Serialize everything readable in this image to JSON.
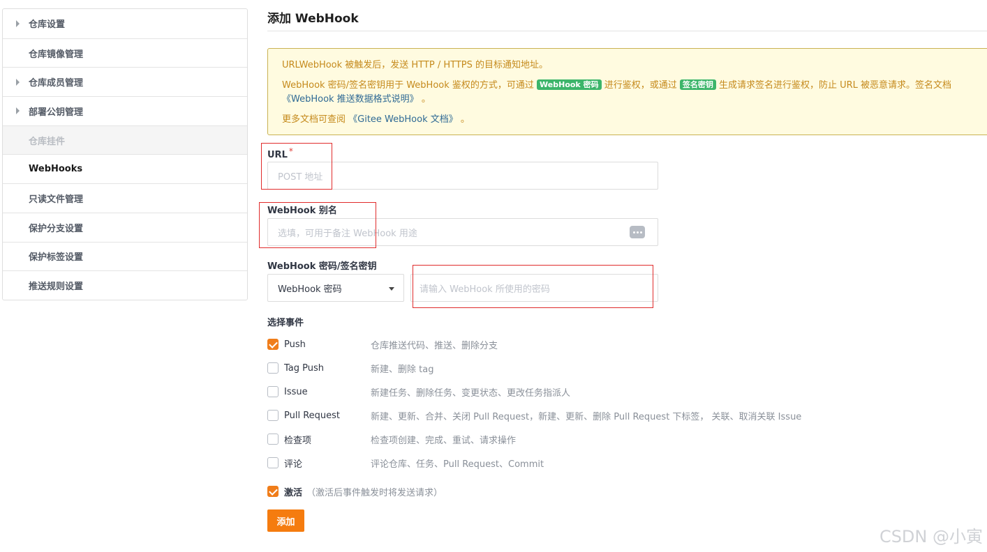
{
  "sidebar": {
    "items": [
      {
        "label": "仓库设置",
        "has_caret": true,
        "state": "normal"
      },
      {
        "label": "仓库镜像管理",
        "has_caret": false,
        "state": "normal"
      },
      {
        "label": "仓库成员管理",
        "has_caret": true,
        "state": "normal"
      },
      {
        "label": "部署公钥管理",
        "has_caret": true,
        "state": "normal"
      },
      {
        "label": "仓库挂件",
        "has_caret": false,
        "state": "disabled"
      },
      {
        "label": "WebHooks",
        "has_caret": false,
        "state": "active"
      },
      {
        "label": "只读文件管理",
        "has_caret": false,
        "state": "normal"
      },
      {
        "label": "保护分支设置",
        "has_caret": false,
        "state": "normal"
      },
      {
        "label": "保护标签设置",
        "has_caret": false,
        "state": "normal"
      },
      {
        "label": "推送规则设置",
        "has_caret": false,
        "state": "normal"
      }
    ]
  },
  "main": {
    "title": "添加 WebHook",
    "notice": {
      "line1": "URLWebHook 被触发后，发送 HTTP / HTTPS 的目标通知地址。",
      "line2_a": "WebHook 密码/签名密钥用于 WebHook 鉴权的方式，可通过 ",
      "badge1": "WebHook 密码",
      "line2_b": " 进行鉴权，或通过 ",
      "badge2": "签名密钥",
      "line2_c": " 生成请求签名进行鉴权，防止 URL 被恶意请求。签名文档",
      "line3_link": "《WebHook 推送数据格式说明》",
      "line3_end": " 。",
      "line4_a": "更多文档可查阅 ",
      "line4_link": "《Gitee WebHook 文档》",
      "line4_end": " 。"
    },
    "url": {
      "label": "URL",
      "required_mark": "*",
      "placeholder": "POST 地址",
      "value": ""
    },
    "alias": {
      "label": "WebHook 别名",
      "placeholder": "选填，可用于备注 WebHook 用途",
      "value": ""
    },
    "secret": {
      "label": "WebHook 密码/签名密钥",
      "select_value": "WebHook 密码",
      "placeholder": "请输入 WebHook 所使用的密码",
      "value": ""
    },
    "events": {
      "label": "选择事件",
      "items": [
        {
          "name": "Push",
          "desc": "仓库推送代码、推送、删除分支",
          "checked": true
        },
        {
          "name": "Tag Push",
          "desc": "新建、删除 tag",
          "checked": false
        },
        {
          "name": "Issue",
          "desc": "新建任务、删除任务、变更状态、更改任务指派人",
          "checked": false
        },
        {
          "name": "Pull Request",
          "desc": "新建、更新、合并、关闭 Pull Request，新建、更新、删除 Pull Request 下标签， 关联、取消关联 Issue",
          "checked": false
        },
        {
          "name": "检查项",
          "desc": "检查项创建、完成、重试、请求操作",
          "checked": false
        },
        {
          "name": "评论",
          "desc": "评论仓库、任务、Pull Request、Commit",
          "checked": false
        }
      ]
    },
    "activate": {
      "label": "激活",
      "hint": "（激活后事件触发时将发送请求）",
      "checked": true
    },
    "submit_label": "添加"
  },
  "watermark": "CSDN @小寅",
  "colors": {
    "accent": "#f57c0f",
    "highlight": "#e02b2b",
    "badge": "#3cb56a",
    "notice_text": "#c58a1c"
  }
}
